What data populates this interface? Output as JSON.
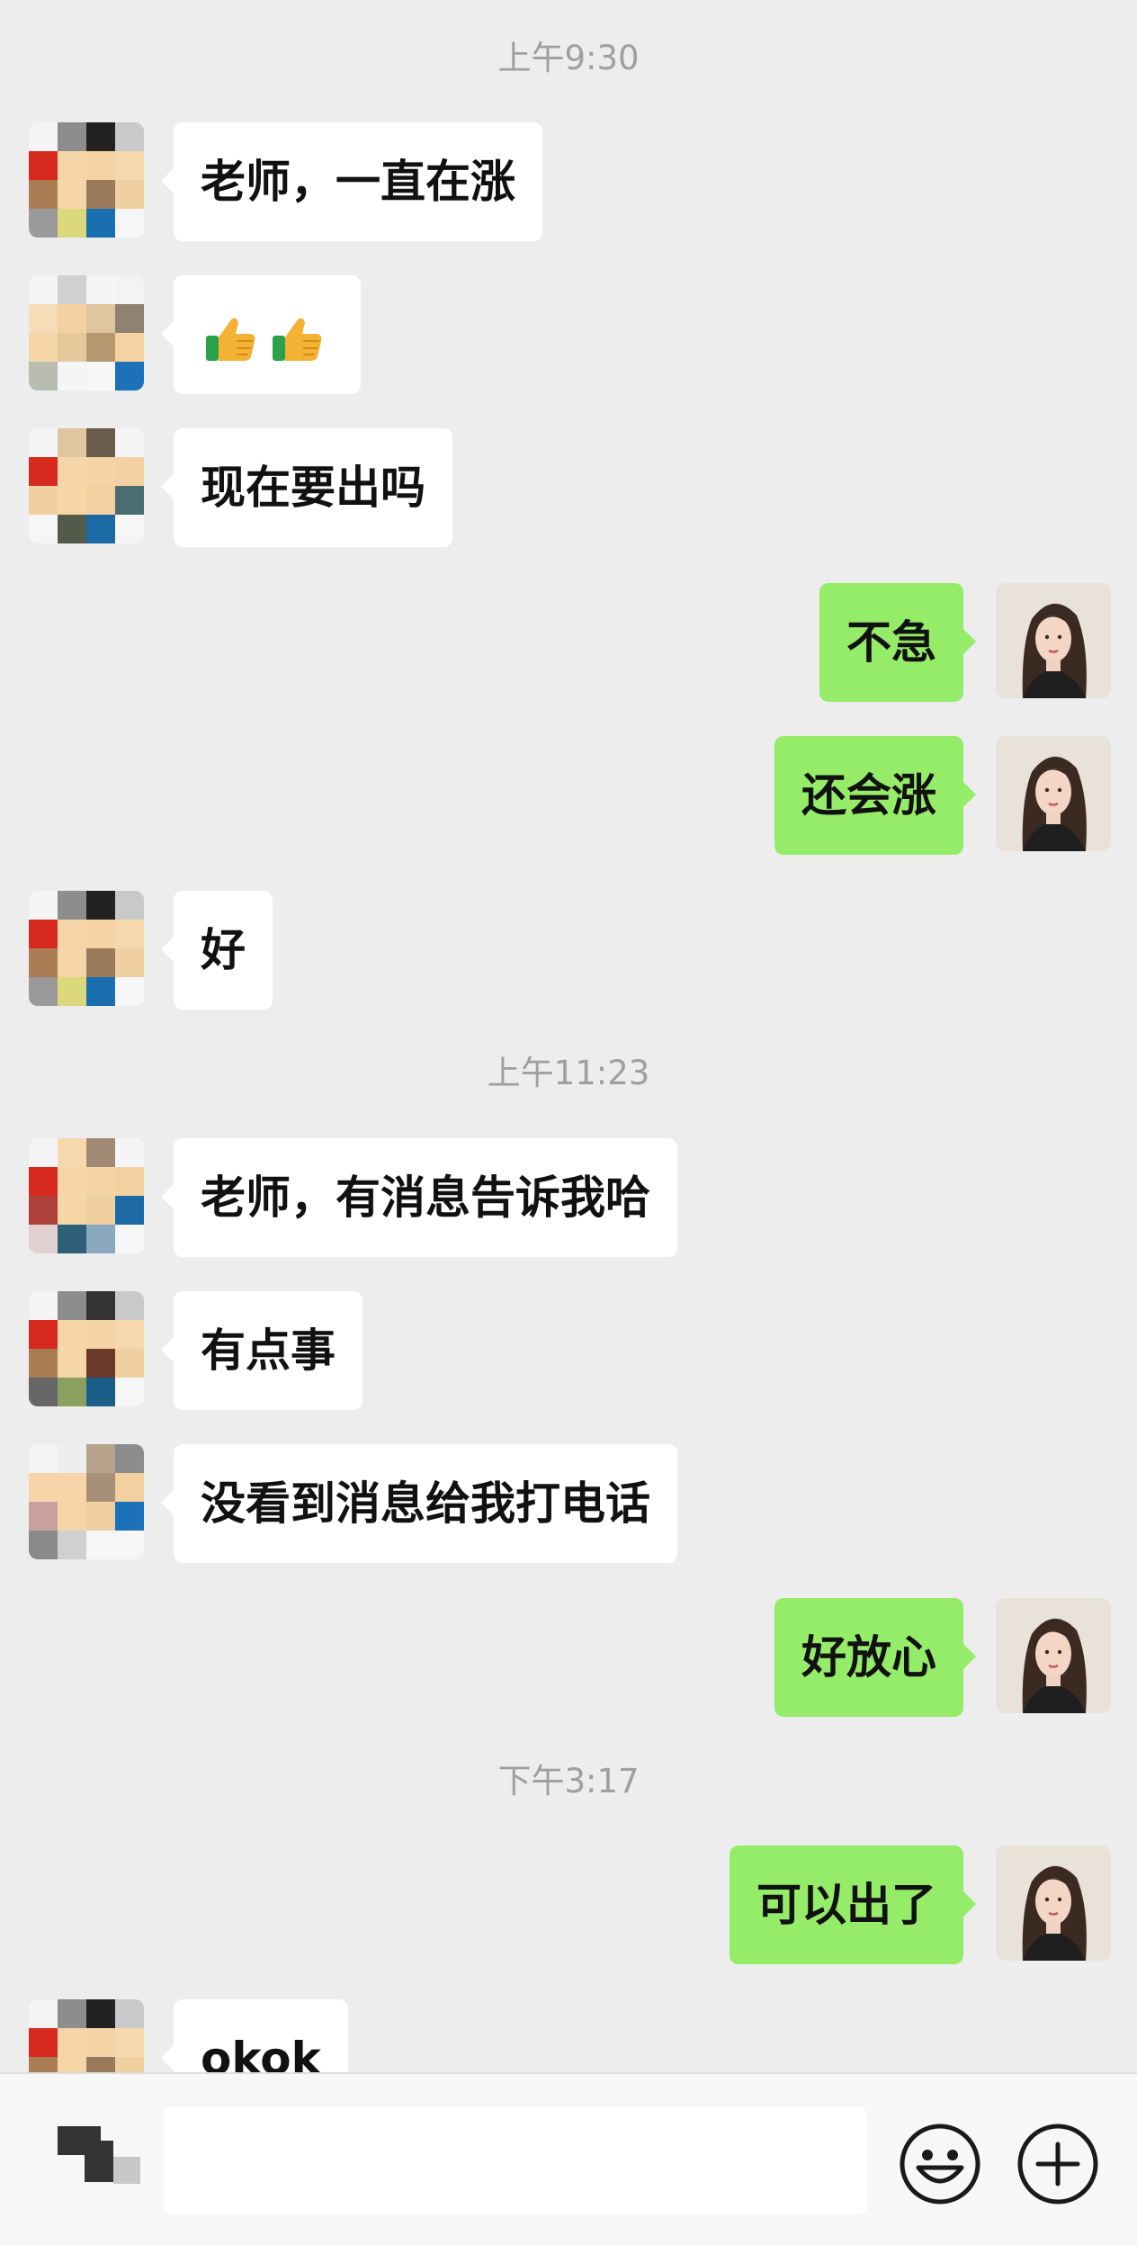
{
  "chat": {
    "timestamps": [
      "上午9:30",
      "上午11:23",
      "下午3:17"
    ],
    "messages": [
      {
        "side": "in",
        "text": "老师，一直在涨"
      },
      {
        "side": "in",
        "text": "",
        "emoji": "thumbs-up x2"
      },
      {
        "side": "in",
        "text": "现在要出吗"
      },
      {
        "side": "out",
        "text": "不急"
      },
      {
        "side": "out",
        "text": "还会涨"
      },
      {
        "side": "in",
        "text": "好"
      },
      {
        "side": "in",
        "text": "老师，有消息告诉我哈"
      },
      {
        "side": "in",
        "text": "有点事"
      },
      {
        "side": "in",
        "text": "没看到消息给我打电话"
      },
      {
        "side": "out",
        "text": "好放心"
      },
      {
        "side": "out",
        "text": "可以出了"
      },
      {
        "side": "in",
        "text": "okok"
      }
    ]
  },
  "input_bar": {
    "text_value": "",
    "icons": [
      "voice-toggle-icon",
      "emoji-icon",
      "plus-icon"
    ]
  },
  "colors": {
    "background": "#ededed",
    "incoming_bubble": "#ffffff",
    "outgoing_bubble": "#95ec69",
    "timestamp_text": "#9f9f9f"
  }
}
